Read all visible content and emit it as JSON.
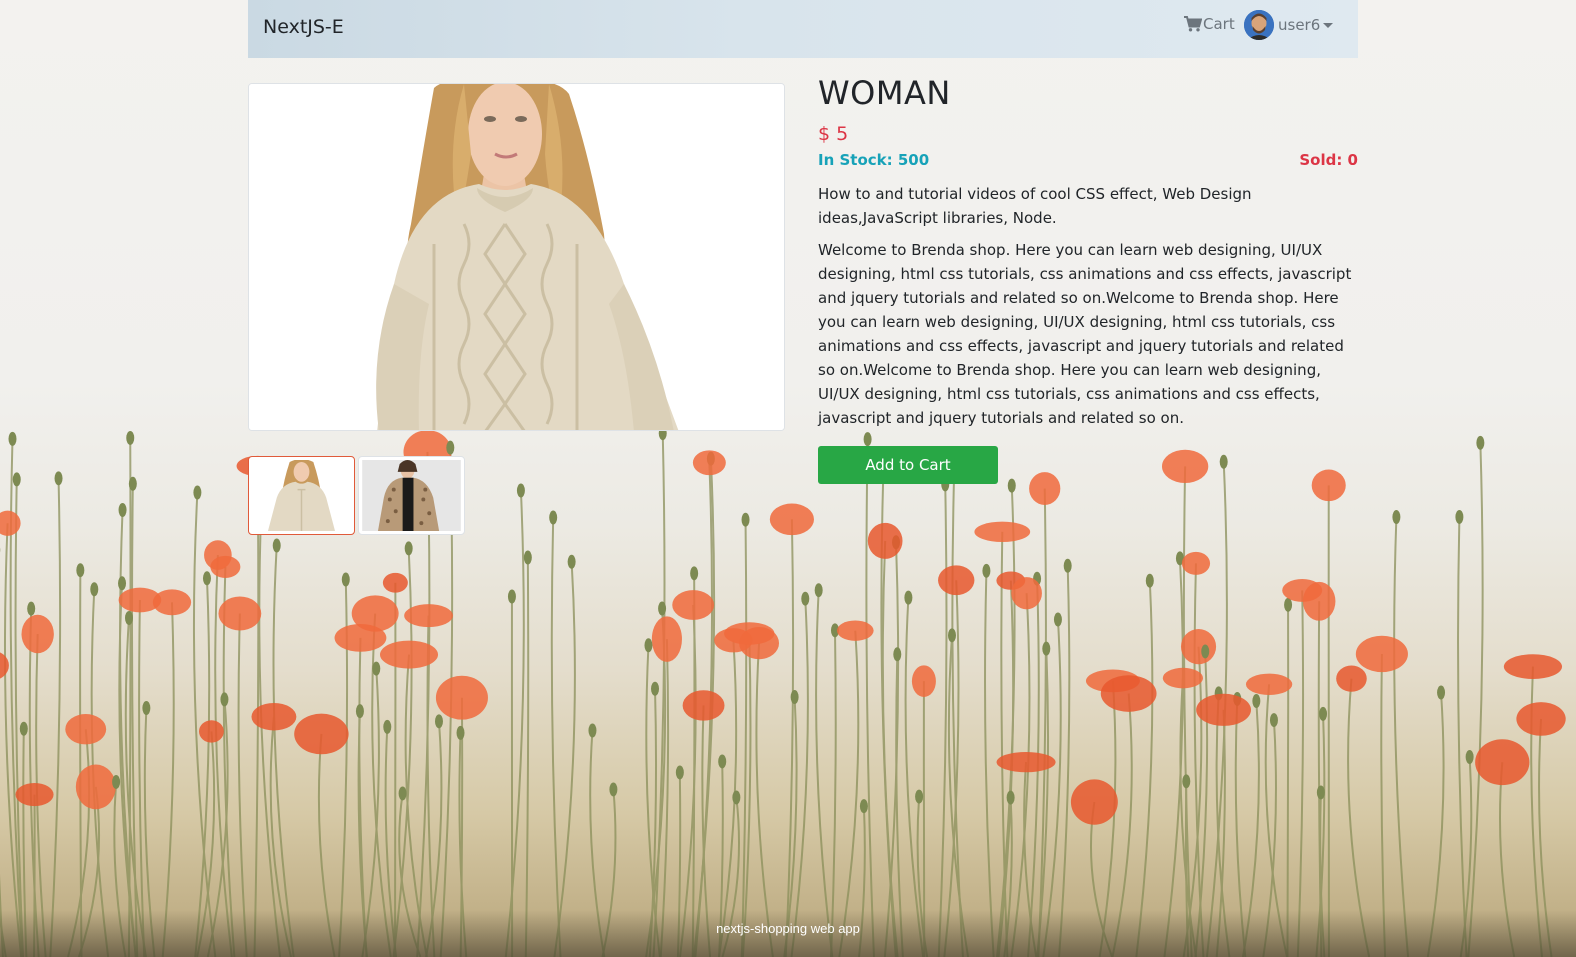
{
  "navbar": {
    "brand": "NextJS-E",
    "cart_label": "Cart",
    "username": "user6"
  },
  "product": {
    "title": "WOMAN",
    "price": "$ 5",
    "in_stock": "In Stock: 500",
    "sold": "Sold: 0",
    "description": "How to and tutorial videos of cool CSS effect, Web Design ideas,JavaScript libraries, Node.",
    "content": "Welcome to Brenda shop. Here you can learn web designing, UI/UX designing, html css tutorials, css animations and css effects, javascript and jquery tutorials and related so on.Welcome to Brenda shop. Here you can learn web designing, UI/UX designing, html css tutorials, css animations and css effects, javascript and jquery tutorials and related so on.Welcome to Brenda shop. Here you can learn web designing, UI/UX designing, html css tutorials, css animations and css effects, javascript and jquery tutorials and related so on.",
    "add_to_cart_label": "Add to Cart"
  },
  "footer": {
    "text": "nextjs-shopping web app"
  },
  "colors": {
    "price": "#dc3545",
    "in_stock": "#17a2b8",
    "sold": "#dc3545",
    "add_button": "#28a745",
    "active_thumb_border": "#e05a3a"
  },
  "icons": {
    "cart": "cart-icon",
    "avatar": "avatar-image",
    "dropdown": "caret-down-icon"
  }
}
